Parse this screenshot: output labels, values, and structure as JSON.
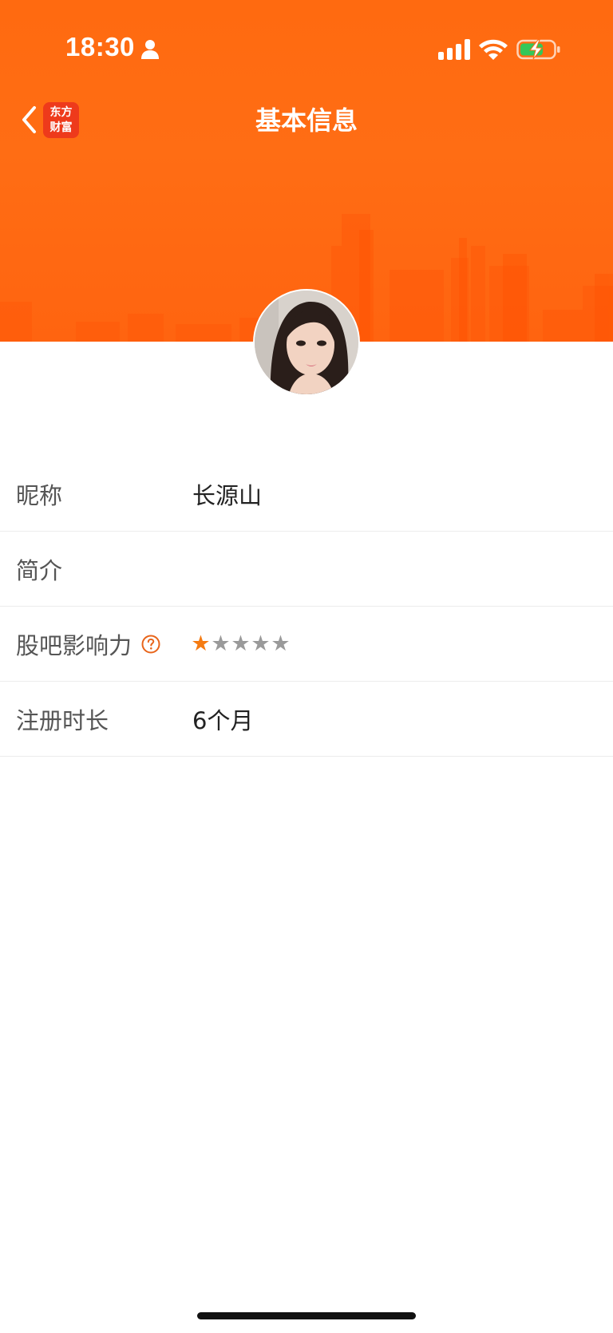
{
  "status_bar": {
    "time": "18:30"
  },
  "nav": {
    "title": "基本信息",
    "app_logo_line1": "东方",
    "app_logo_line2": "财富"
  },
  "colors": {
    "brand_orange": "#ff6a10",
    "star_active": "#f57b12",
    "star_inactive": "#9a9a9a",
    "help_icon": "#e8641a",
    "battery_fill": "#34c759"
  },
  "profile": {
    "rows": [
      {
        "label": "昵称",
        "value": "长源山"
      },
      {
        "label": "简介",
        "value": ""
      },
      {
        "label": "股吧影响力",
        "stars_filled": 1,
        "stars_total": 5,
        "help_icon": "question-circle-icon"
      },
      {
        "label": "注册时长",
        "value": "6个月"
      }
    ]
  },
  "icons": {
    "back": "chevron-left-icon",
    "person": "person-icon",
    "signal": "cellular-signal-icon",
    "wifi": "wifi-icon",
    "battery": "battery-charging-icon"
  }
}
